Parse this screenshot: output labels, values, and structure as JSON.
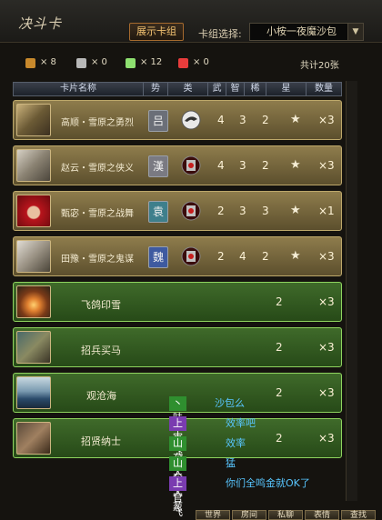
{
  "header": {
    "title": "决斗卡",
    "show_deck_button": "展示卡组",
    "deck_select_label": "卡组选择:",
    "deck_select_value": "小桉一夜魔沙包",
    "dropdown_arrow": "▼"
  },
  "stats": {
    "items": [
      {
        "color": "#c8892c",
        "count": "× 8"
      },
      {
        "color": "#b8b8b8",
        "count": "× 0"
      },
      {
        "color": "#8ee070",
        "count": "× 12"
      },
      {
        "color": "#e83c3c",
        "count": "× 0"
      }
    ],
    "total": "共计20张"
  },
  "table": {
    "headers": [
      "卡片名称",
      "势",
      "类",
      "武",
      "智",
      "稀",
      "星",
      "数量"
    ],
    "general_rows": [
      {
        "name": "高顺・雪原之勇烈",
        "faction": "吕",
        "faction_color": "#6b6f78",
        "wu": "4",
        "zhi": "3",
        "xi": "2",
        "qty": "×3"
      },
      {
        "name": "赵云・雪原之侠义",
        "faction": "漢",
        "faction_color": "#7a7a82",
        "wu": "4",
        "zhi": "3",
        "xi": "2",
        "qty": "×3"
      },
      {
        "name": "甄宓・雪原之战舞",
        "faction": "袁",
        "faction_color": "#3e7f8c",
        "wu": "2",
        "zhi": "3",
        "xi": "3",
        "qty": "×1"
      },
      {
        "name": "田豫・雪原之鬼谋",
        "faction": "魏",
        "faction_color": "#3e5aa0",
        "wu": "2",
        "zhi": "4",
        "xi": "2",
        "qty": "×3"
      }
    ],
    "star": "★",
    "tactic_rows": [
      {
        "name": "飞鸽印雪",
        "rarity": "2",
        "qty": "×3"
      },
      {
        "name": "招兵买马",
        "rarity": "2",
        "qty": "×3"
      },
      {
        "name": "观沧海",
        "rarity": "2",
        "qty": "×3"
      },
      {
        "name": "招贤纳士",
        "rarity": "2",
        "qty": "×3"
      }
    ]
  },
  "chat": {
    "lines": [
      {
        "tag": "丶昧丨",
        "tag_color": "#2f8f2f",
        "text": "沙包么"
      },
      {
        "tag": "上官飞虹",
        "tag_color": "#7a3cb0",
        "text": "效率吧"
      },
      {
        "tag": "山东大葱",
        "tag_color": "#2f8f2f",
        "text": "效率"
      },
      {
        "tag": "山东大葱",
        "tag_color": "#2f8f2f",
        "text": "猛"
      },
      {
        "tag": "上官飞虹",
        "tag_color": "#7a3cb0",
        "text": "你们全鸣金就OK了"
      }
    ]
  },
  "bottom_tabs": [
    "世界",
    "房间",
    "私聊",
    "表情",
    "查找"
  ]
}
